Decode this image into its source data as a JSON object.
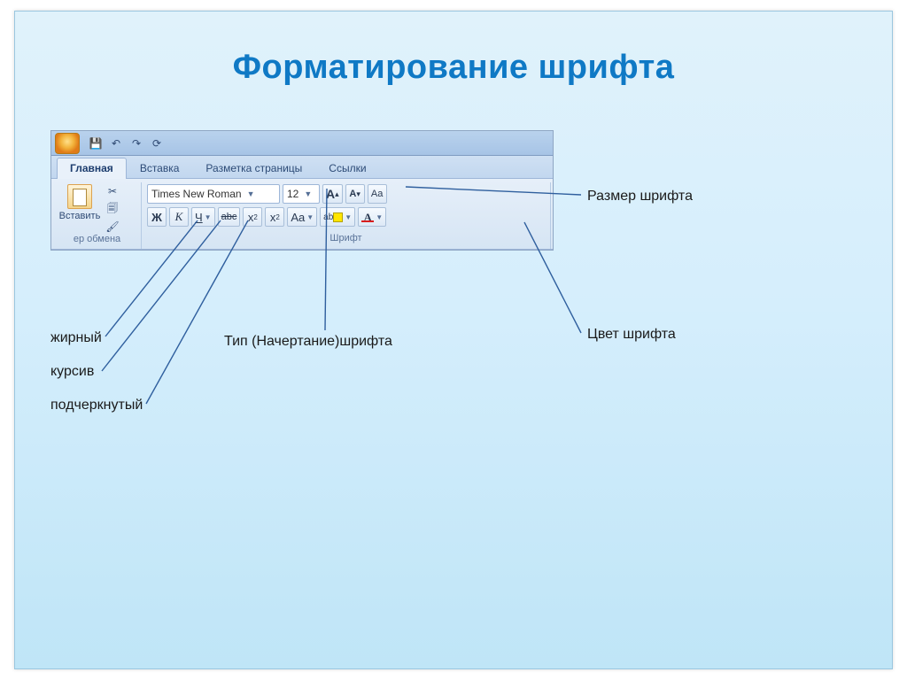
{
  "title": "Форматирование шрифта",
  "ribbon": {
    "qat_icons": [
      "save-icon",
      "undo-icon",
      "redo-icon",
      "refresh-icon"
    ],
    "tabs": {
      "home": "Главная",
      "insert": "Вставка",
      "layout": "Разметка страницы",
      "refs": "Ссылки"
    },
    "clipboard": {
      "paste_label": "Вставить",
      "group_label": "ер обмена"
    },
    "font": {
      "family": "Times New Roman",
      "size": "12",
      "group_label": "Шрифт",
      "bold": "Ж",
      "italic": "К",
      "underline": "Ч",
      "strike": "abc",
      "sub": "x",
      "sup": "x",
      "case": "Aa",
      "grow_a": "A",
      "shrink_a": "A",
      "clear": "Aa",
      "highlight": "ab",
      "font_color": "A"
    }
  },
  "annotations": {
    "font_size": "Размер шрифта",
    "font_color": "Цвет шрифта",
    "font_type": "Тип (Начертание)шрифта",
    "bold": "жирный",
    "italic": "курсив",
    "underline": "подчеркнутый"
  }
}
